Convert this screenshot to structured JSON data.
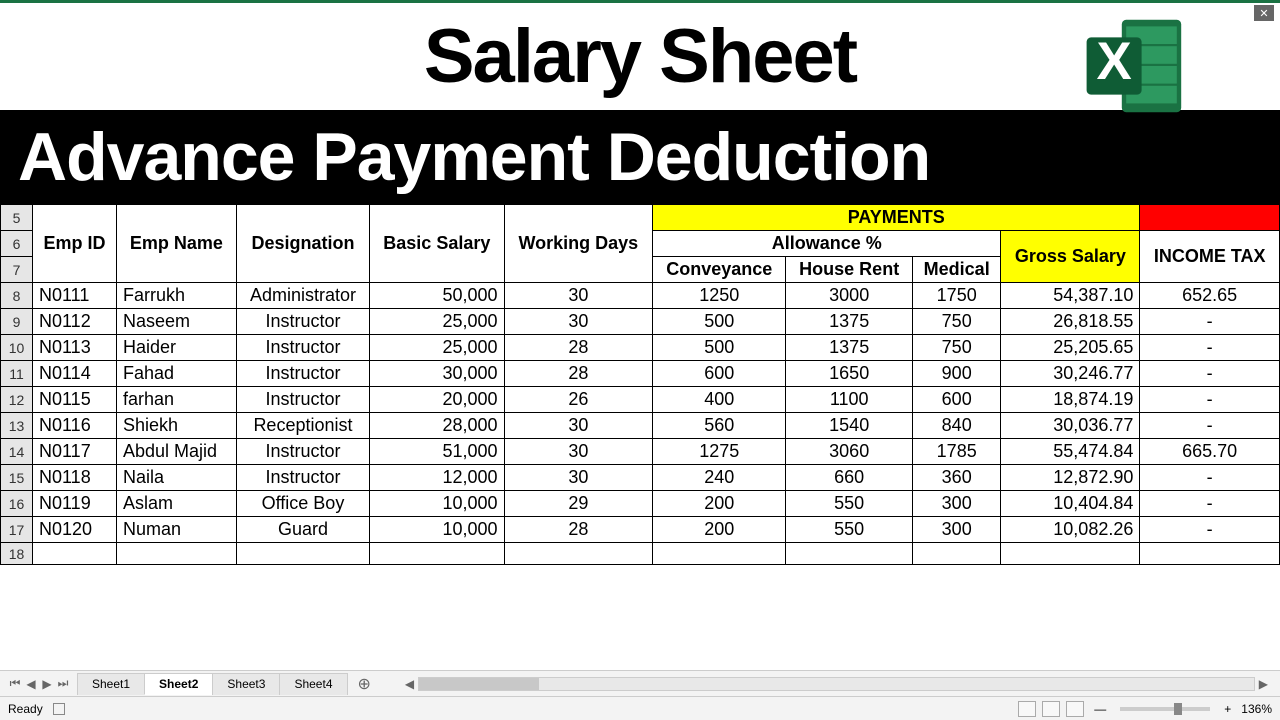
{
  "title": "Salary Sheet",
  "subtitle": "Advance Payment Deduction",
  "headers": {
    "empId": "Emp ID",
    "empName": "Emp Name",
    "designation": "Designation",
    "basicSalary": "Basic Salary",
    "workingDays": "Working Days",
    "payments": "PAYMENTS",
    "allowance": "Allowance %",
    "conveyance": "Conveyance",
    "houseRent": "House Rent",
    "medical": "Medical",
    "grossSalary": "Gross Salary",
    "incomeTax": "INCOME TAX"
  },
  "rowNumbers": [
    "5",
    "6",
    "7",
    "8",
    "9",
    "10",
    "11",
    "12",
    "13",
    "14",
    "15",
    "16",
    "17",
    "18"
  ],
  "rows": [
    {
      "id": "N0111",
      "name": "Farrukh",
      "desig": "Administrator",
      "basic": "50,000",
      "days": "30",
      "conv": "1250",
      "rent": "3000",
      "med": "1750",
      "gross": "54,387.10",
      "tax": "652.65"
    },
    {
      "id": "N0112",
      "name": "Naseem",
      "desig": "Instructor",
      "basic": "25,000",
      "days": "30",
      "conv": "500",
      "rent": "1375",
      "med": "750",
      "gross": "26,818.55",
      "tax": "-"
    },
    {
      "id": "N0113",
      "name": "Haider",
      "desig": "Instructor",
      "basic": "25,000",
      "days": "28",
      "conv": "500",
      "rent": "1375",
      "med": "750",
      "gross": "25,205.65",
      "tax": "-"
    },
    {
      "id": "N0114",
      "name": "Fahad",
      "desig": "Instructor",
      "basic": "30,000",
      "days": "28",
      "conv": "600",
      "rent": "1650",
      "med": "900",
      "gross": "30,246.77",
      "tax": "-"
    },
    {
      "id": "N0115",
      "name": "farhan",
      "desig": "Instructor",
      "basic": "20,000",
      "days": "26",
      "conv": "400",
      "rent": "1100",
      "med": "600",
      "gross": "18,874.19",
      "tax": "-"
    },
    {
      "id": "N0116",
      "name": "Shiekh",
      "desig": "Receptionist",
      "basic": "28,000",
      "days": "30",
      "conv": "560",
      "rent": "1540",
      "med": "840",
      "gross": "30,036.77",
      "tax": "-"
    },
    {
      "id": "N0117",
      "name": "Abdul Majid",
      "desig": "Instructor",
      "basic": "51,000",
      "days": "30",
      "conv": "1275",
      "rent": "3060",
      "med": "1785",
      "gross": "55,474.84",
      "tax": "665.70"
    },
    {
      "id": "N0118",
      "name": "Naila",
      "desig": "Instructor",
      "basic": "12,000",
      "days": "30",
      "conv": "240",
      "rent": "660",
      "med": "360",
      "gross": "12,872.90",
      "tax": "-"
    },
    {
      "id": "N0119",
      "name": "Aslam",
      "desig": "Office Boy",
      "basic": "10,000",
      "days": "29",
      "conv": "200",
      "rent": "550",
      "med": "300",
      "gross": "10,404.84",
      "tax": "-"
    },
    {
      "id": "N0120",
      "name": "Numan",
      "desig": "Guard",
      "basic": "10,000",
      "days": "28",
      "conv": "200",
      "rent": "550",
      "med": "300",
      "gross": "10,082.26",
      "tax": "-"
    }
  ],
  "tabs": [
    "Sheet1",
    "Sheet2",
    "Sheet3",
    "Sheet4"
  ],
  "activeTab": 1,
  "status": {
    "ready": "Ready",
    "zoom": "136%",
    "plus": "+",
    "minus": "—"
  }
}
